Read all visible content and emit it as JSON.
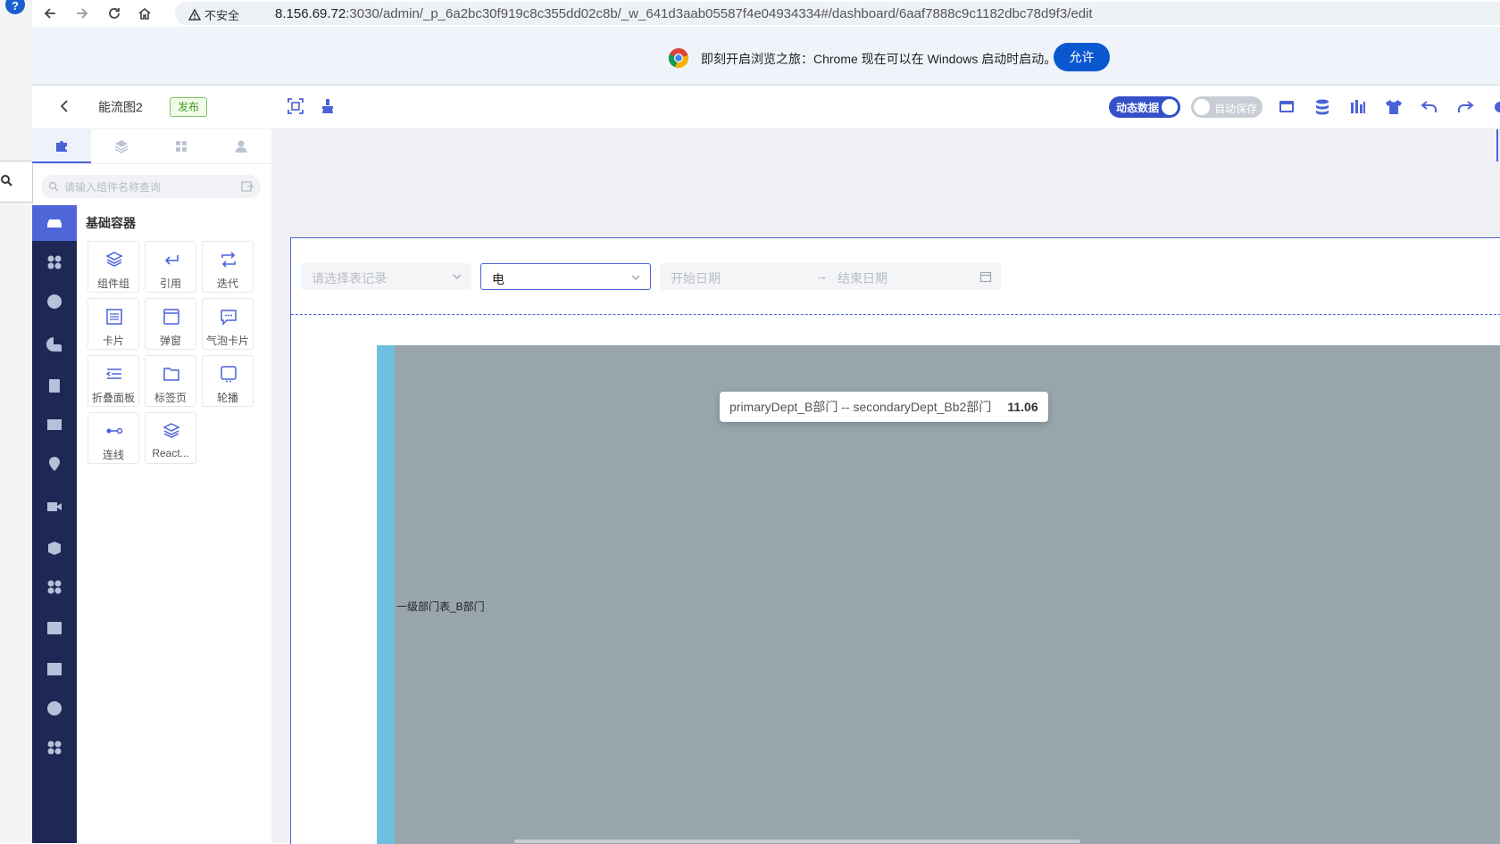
{
  "browser": {
    "insecure_label": "不安全",
    "url_host": "8.156.69.72",
    "url_rest": ":3030/admin/_p_6a2bc30f919c8c355dd02c8b/_w_641d3aab05587f4e04934334#/dashboard/6aaf7888c9c1182dbc78d9f3/edit",
    "help_glyph": "?"
  },
  "banner": {
    "message": "即刻开启浏览之旅：Chrome 现在可以在 Windows 启动时启动。",
    "allow_label": "允许"
  },
  "header": {
    "title": "能流图2",
    "publish_badge": "发布",
    "dynamic_data_label": "动态数据",
    "auto_save_label": "自动保存",
    "dynamic_data_on": true,
    "auto_save_on": false
  },
  "left_panel": {
    "tabs": [
      "components-tab",
      "layers-tab",
      "templates-tab",
      "user-tab"
    ],
    "search_placeholder": "请输入组件名称查询",
    "section_title": "基础容器",
    "components": [
      {
        "label": "组件组",
        "icon": "layers-icon"
      },
      {
        "label": "引用",
        "icon": "return-arrow-icon"
      },
      {
        "label": "迭代",
        "icon": "repeat-icon"
      },
      {
        "label": "卡片",
        "icon": "card-icon"
      },
      {
        "label": "弹窗",
        "icon": "window-icon"
      },
      {
        "label": "气泡卡片",
        "icon": "speech-bubble-icon"
      },
      {
        "label": "折叠面板",
        "icon": "collapse-list-icon"
      },
      {
        "label": "标签页",
        "icon": "folder-tab-icon"
      },
      {
        "label": "轮播",
        "icon": "carousel-icon"
      },
      {
        "label": "连线",
        "icon": "link-line-icon"
      },
      {
        "label": "React...",
        "icon": "layers-icon"
      }
    ]
  },
  "canvas": {
    "filters": {
      "table_record_placeholder": "请选择表记录",
      "energy_type_value": "电",
      "start_date_placeholder": "开始日期",
      "end_date_placeholder": "结束日期",
      "range_arrow": "→"
    },
    "chart": {
      "node_label": "一级部门表_B部门",
      "tooltip_name": "primaryDept_B部门 -- secondaryDept_Bb2部门",
      "tooltip_value": "11.06"
    }
  },
  "colors": {
    "accent": "#4a62d8",
    "category_bar": "#1d2855",
    "chart_bg": "#98a5ad",
    "node": "#6fbfe0",
    "allow_button": "#0b57d0"
  }
}
